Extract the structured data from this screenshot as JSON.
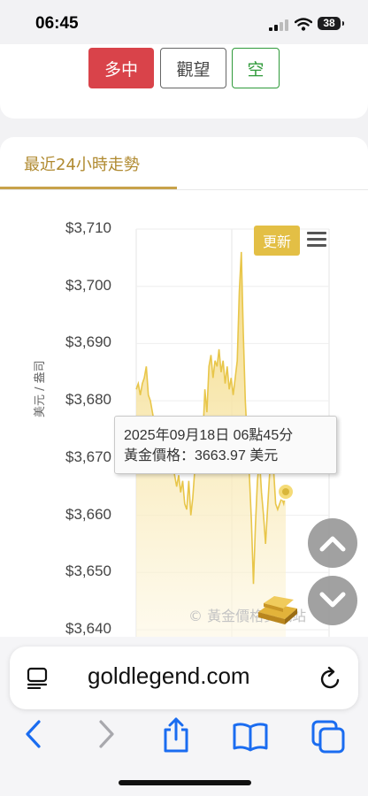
{
  "status": {
    "time": "06:45",
    "battery": "38"
  },
  "vote": {
    "long": "多中",
    "watch": "觀望",
    "short": "空"
  },
  "tab": {
    "label": "最近24小時走勢"
  },
  "chart_data": {
    "type": "area",
    "ylabel": "美元 / 盎司",
    "ylim": [
      3640,
      3710
    ],
    "yticks": [
      "$3,710",
      "$3,700",
      "$3,690",
      "$3,680",
      "$3,670",
      "$3,660",
      "$3,650",
      "$3,640"
    ],
    "series": [
      {
        "values": [
          3682,
          3683,
          3681,
          3683,
          3684,
          3686,
          3681,
          3680,
          3678,
          3676,
          3675,
          3674,
          3673,
          3672,
          3674,
          3673,
          3670,
          3668,
          3669,
          3667,
          3665,
          3667,
          3664,
          3666,
          3662,
          3661,
          3666,
          3660,
          3663,
          3668,
          3672,
          3671,
          3675,
          3674,
          3682,
          3678,
          3686,
          3688,
          3684,
          3687,
          3686,
          3689,
          3685,
          3687,
          3683,
          3686,
          3682,
          3684,
          3681,
          3684,
          3687,
          3699,
          3706,
          3692,
          3680,
          3673,
          3667,
          3659,
          3648,
          3658,
          3666,
          3670,
          3664,
          3660,
          3655,
          3661,
          3667,
          3670,
          3668,
          3662,
          3661,
          3662,
          3663,
          3662,
          3663.97
        ]
      }
    ],
    "colors": {
      "line": "#e8c64a",
      "fill_top": "#f3d77a",
      "fill_bottom": "#fdf7e2"
    }
  },
  "chart": {
    "update_label": "更新",
    "tooltip_date": "2025年09月18日 06點45分",
    "tooltip_price": "黃金價格：3663.97 美元",
    "watermark": "© 黃金價格資訊站"
  },
  "browser": {
    "url": "goldlegend.com"
  },
  "icons": [
    "signal-icon",
    "wifi-icon",
    "menu-icon",
    "gold-bar-icon",
    "chevron-up-icon",
    "chevron-down-icon",
    "reader-icon",
    "reload-icon",
    "back-icon",
    "forward-icon",
    "share-icon",
    "bookmarks-icon",
    "tabs-icon"
  ]
}
